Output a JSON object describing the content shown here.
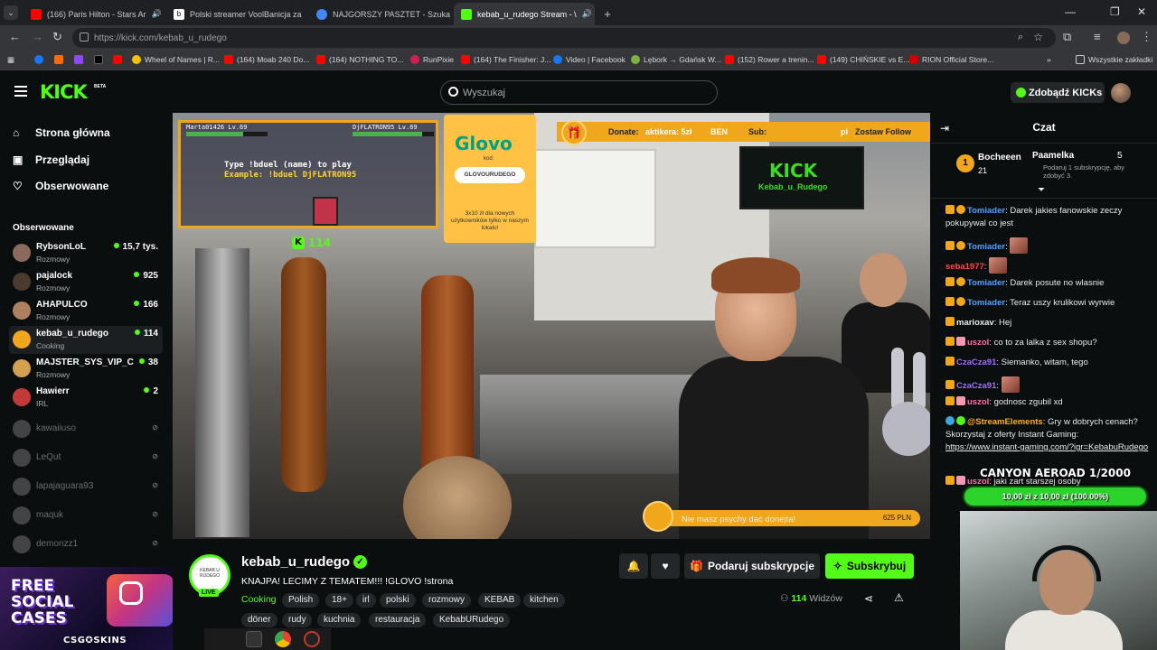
{
  "browser": {
    "tabs": [
      {
        "title": "(166) Paris Hilton - Stars Ar",
        "icon": "youtube-icon",
        "color": "#ff0000"
      },
      {
        "title": "Polski streamer VoolBanicja za",
        "icon": "bing-icon",
        "color": "#ffffff"
      },
      {
        "title": "NAJGORSZY PASZTET - Szukaj",
        "icon": "google-icon",
        "color": "#4285f4"
      },
      {
        "title": "kebab_u_rudego Stream - \\",
        "icon": "kick-icon",
        "color": "#53fc18"
      }
    ],
    "url_host": "https://kick.com/",
    "url_path": "kebab_u_rudego",
    "bookmarks": [
      {
        "label": "Wheel of Names | R...",
        "color": "#f3c200"
      },
      {
        "label": "(164) Moab 240 Do...",
        "color": "#ff0000"
      },
      {
        "label": "(164) NOTHING TO...",
        "color": "#ff0000"
      },
      {
        "label": "RunPixie",
        "color": "#d02050"
      },
      {
        "label": "(164) The Finisher: J...",
        "color": "#ff0000"
      },
      {
        "label": "Video | Facebook",
        "color": "#1877f2"
      },
      {
        "label": "Lębork → Gdańsk W...",
        "color": "#7cb342"
      },
      {
        "label": "(152) Rower a trenin...",
        "color": "#ff0000"
      },
      {
        "label": "(149) CHIŃSKIE vs E...",
        "color": "#ff0000"
      },
      {
        "label": "RION Official Store...",
        "color": "#cc0000"
      }
    ],
    "all_bookmarks": "Wszystkie zakładki"
  },
  "header": {
    "logo": "KICK",
    "beta": "BETA",
    "search_placeholder": "Wyszukaj",
    "get_kicks": "Zdobądź KICKs"
  },
  "sidebar": {
    "nav": [
      "Strona główna",
      "Przeglądaj",
      "Obserwowane"
    ],
    "followed_heading": "Obserwowane",
    "channels": [
      {
        "name": "RybsonLoL",
        "category": "Rozmowy",
        "viewers": "15,7 tys.",
        "live": true,
        "color": "#8a6a5a"
      },
      {
        "name": "pajalock",
        "category": "Rozmowy",
        "viewers": "925",
        "live": true,
        "color": "#4a3a30"
      },
      {
        "name": "AHAPULCO",
        "category": "Rozmowy",
        "viewers": "166",
        "live": true,
        "color": "#b08060"
      },
      {
        "name": "kebab_u_rudego",
        "category": "Cooking",
        "viewers": "114",
        "live": true,
        "color": "#f0a71b"
      },
      {
        "name": "MAJSTER_SYS_VIP_C",
        "category": "Rozmowy",
        "viewers": "38",
        "live": true,
        "color": "#d4a050"
      },
      {
        "name": "Hawierr",
        "category": "IRL",
        "viewers": "2",
        "live": true,
        "color": "#c03a3a"
      },
      {
        "name": "kawaiiuso",
        "live": false,
        "color": "#888888"
      },
      {
        "name": "LeQut",
        "live": false,
        "color": "#888888"
      },
      {
        "name": "lapajaguara93",
        "live": false,
        "color": "#888888"
      },
      {
        "name": "maquk",
        "live": false,
        "color": "#888888"
      },
      {
        "name": "demonzz1",
        "live": false,
        "color": "#888888"
      }
    ]
  },
  "ad": {
    "title": "FREE SOCIAL CASES",
    "brand": "CSG✪SKINS"
  },
  "video": {
    "duel_left": "Marta01426 Lv.69",
    "duel_right": "DjFLATRON95 Lv.69",
    "duel_line1": "Type !bduel (name) to play",
    "duel_line2": "Example: !bduel DjFLATRON95",
    "kicks_count": "114",
    "glovo_logo": "Glovo",
    "glovo_code_label": "kod:",
    "glovo_code": "GLOVOURUDEGO",
    "glovo_promo": "3x10 zł dla nowych użytkowników tylko w naszym lokalu!",
    "donate_label": "Donate:",
    "donate_value": "aktikera: 5zł",
    "donate_extra": "BEN",
    "sub_label": "Sub:",
    "follow_text": "Zostaw Follow",
    "follow_prefix": "pi",
    "tv_brand": "KICK",
    "tv_sub": "Kebab_u_Rudego",
    "bottom_msg": "Nie masz psychy dać donejta!",
    "bottom_amount": "625 PLN"
  },
  "stream": {
    "avatar_text": "KEBAB U RUDEGO",
    "live_badge": "LIVE",
    "channel_name": "kebab_u_rudego",
    "title": "KNAJPA! LECIMY Z TEMATEM!!! !GLOVO !strona",
    "category": "Cooking",
    "tags_row1": [
      "Polish",
      "18+",
      "irl",
      "polski",
      "rozmowy",
      "KEBAB",
      "kitchen"
    ],
    "tags_row2": [
      "döner",
      "rudy",
      "kuchnia",
      "restauracja",
      "KebabURudego"
    ],
    "gift_sub": "Podaruj subskrypcje",
    "subscribe": "Subskrybuj",
    "viewers_count": "114",
    "viewers_label": "Widzów"
  },
  "chat": {
    "title": "Czat",
    "pinned": [
      {
        "name": "Bocheeen",
        "rank": "1",
        "count": "21"
      },
      {
        "name": "Paamelka",
        "count": "5",
        "note": "Podaruj 1 subskrypcję, aby zdobyć 3."
      }
    ],
    "messages": [
      {
        "user": "Tomiader",
        "color": "#4da3ff",
        "text": "Darek jakies fanowskie zeczy pokupywal co jest"
      },
      {
        "user": "Tomiader",
        "color": "#4da3ff",
        "text": ""
      },
      {
        "user": "seba1977",
        "color": "#ff4a4a",
        "text": ""
      },
      {
        "user": "Tomiader",
        "color": "#4da3ff",
        "text": "Darek posute no wlasnie"
      },
      {
        "user": "Tomiader",
        "color": "#4da3ff",
        "text": "Teraz uszy krulikowi wyrwie"
      },
      {
        "user": "marioxav",
        "color": "#e8eaed",
        "text": "Hej"
      },
      {
        "user": "uszol",
        "color": "#ff6fa8",
        "text": "co to za lalka z sex shopu?"
      },
      {
        "user": "CzaCza91",
        "color": "#a070ff",
        "text": "Siemanko, witam, tego"
      },
      {
        "user": "CzaCza91",
        "color": "#a070ff",
        "text": ""
      },
      {
        "user": "uszol",
        "color": "#ff6fa8",
        "text": "godnosc zgubil xd"
      },
      {
        "user": "@StreamElements",
        "color": "#ffb020",
        "text": "Gry w dobrych cenach? Skorzystaj z oferty Instant Gaming:"
      },
      {
        "user": "",
        "color": "#e8eaed",
        "text": "https://www.instant-gaming.com/?igr=KebabuRudego"
      },
      {
        "user": "uszol",
        "color": "#ff6fa8",
        "text": "jaki zart starszej osoby"
      }
    ],
    "goal_title": "CANYON AEROAD 1/2000",
    "goal_progress": "10,00 zł z 10,00 zł (100.00%)",
    "goal_fraction": 1.0
  }
}
